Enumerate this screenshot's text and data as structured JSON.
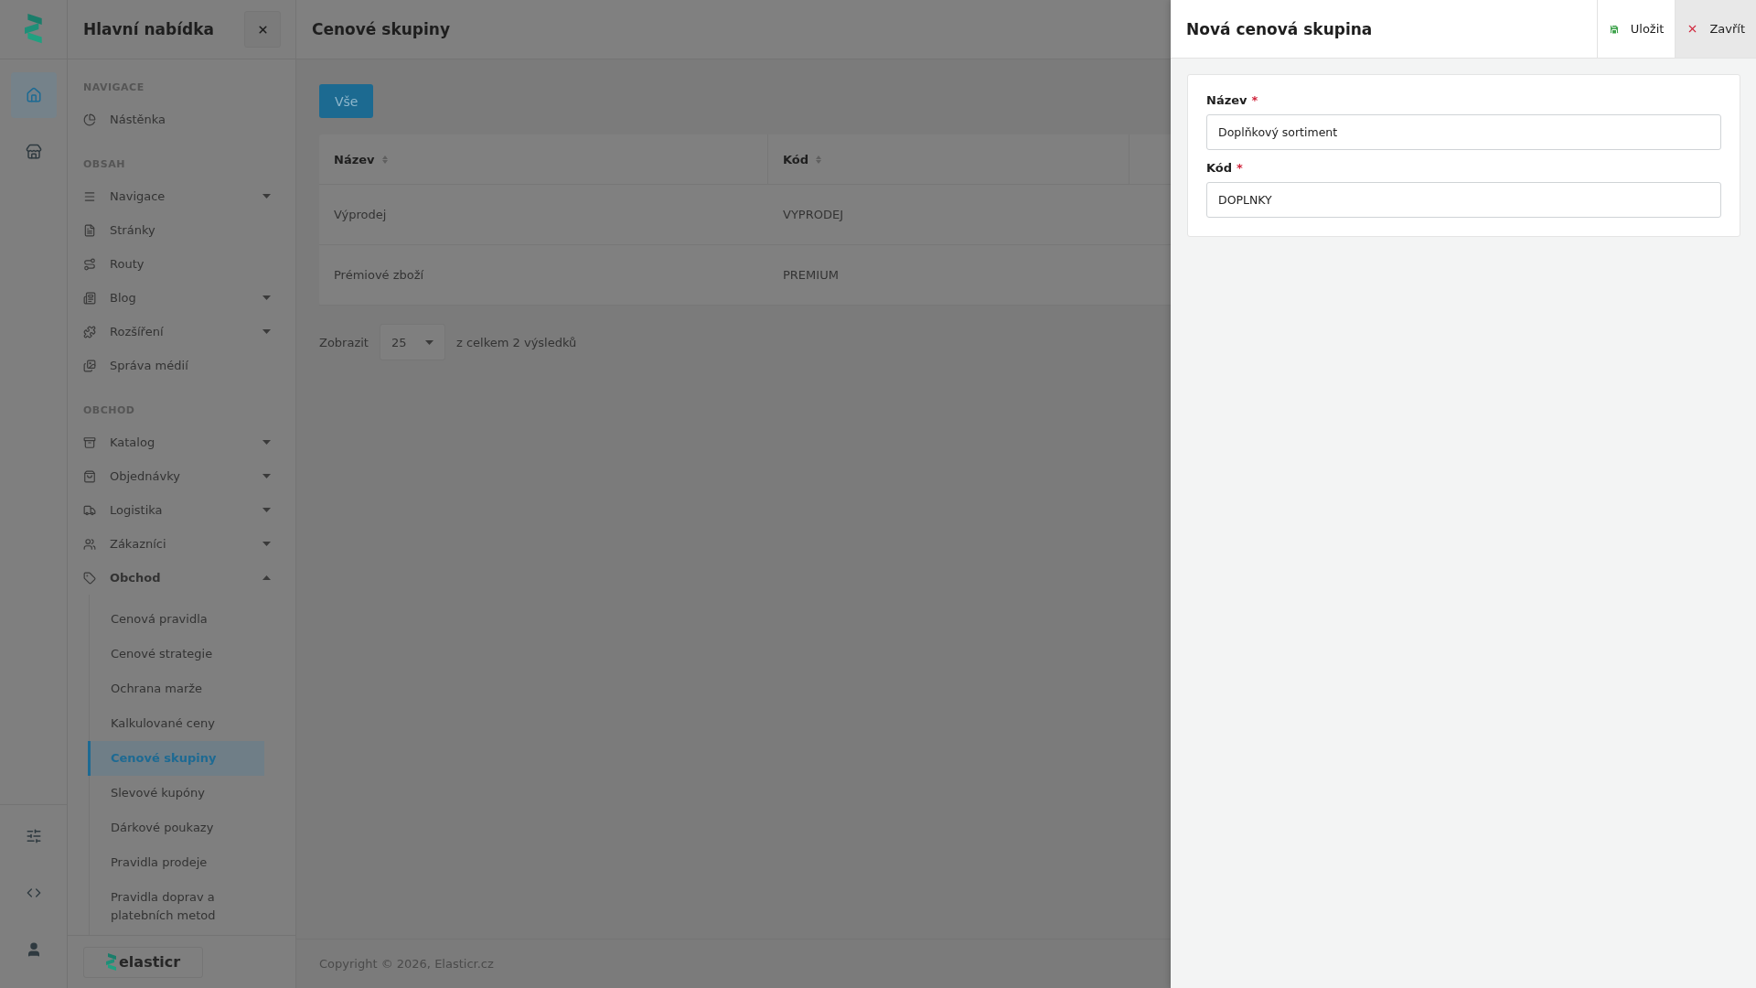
{
  "rail": {
    "top": [
      {
        "selected": true
      },
      {
        "selected": false
      }
    ]
  },
  "menu": {
    "title": "Hlavní nabídka",
    "sections": [
      {
        "heading": "NAVIGACE",
        "items": [
          {
            "label": "Nástěnka"
          }
        ]
      },
      {
        "heading": "OBSAH",
        "items": [
          {
            "label": "Navigace",
            "expanded": false
          },
          {
            "label": "Stránky"
          },
          {
            "label": "Routy"
          },
          {
            "label": "Blog",
            "expanded": false
          },
          {
            "label": "Rozšíření",
            "expanded": false
          },
          {
            "label": "Správa médií"
          }
        ]
      },
      {
        "heading": "OBCHOD",
        "items": [
          {
            "label": "Katalog",
            "expanded": false
          },
          {
            "label": "Objednávky",
            "expanded": false
          },
          {
            "label": "Logistika",
            "expanded": false
          },
          {
            "label": "Zákazníci",
            "expanded": false
          },
          {
            "label": "Obchod",
            "expanded": true,
            "children": [
              {
                "label": "Cenová pravidla",
                "selected": false
              },
              {
                "label": "Cenové strategie",
                "selected": false
              },
              {
                "label": "Ochrana marže",
                "selected": false
              },
              {
                "label": "Kalkulované ceny",
                "selected": false
              },
              {
                "label": "Cenové skupiny",
                "selected": true
              },
              {
                "label": "Slevové kupóny",
                "selected": false
              },
              {
                "label": "Dárkové poukazy",
                "selected": false
              },
              {
                "label": "Pravidla prodeje",
                "selected": false
              },
              {
                "label": "Pravidla doprav a platebních metod",
                "selected": false
              }
            ]
          }
        ]
      }
    ],
    "brand": "elasticr"
  },
  "main": {
    "title": "Cenové skupiny",
    "filter_button": "Vše",
    "table": {
      "columns": [
        "Název",
        "Kód"
      ],
      "rows": [
        [
          "Výprodej",
          "VYPRODEJ"
        ],
        [
          "Prémiové zboží",
          "PREMIUM"
        ]
      ]
    },
    "pagination": {
      "label": "Zobrazit",
      "page_size": "25",
      "summary": "z celkem 2 výsledků"
    },
    "footer": "Copyright © 2026, Elasticr.cz"
  },
  "drawer": {
    "title": "Nová cenová skupina",
    "save": "Uložit",
    "close": "Zavřít",
    "fields": [
      {
        "label": "Název",
        "required_mark": "*",
        "value": "Doplňkový sortiment"
      },
      {
        "label": "Kód",
        "required_mark": "*",
        "value": "DOPLNKY"
      }
    ]
  }
}
